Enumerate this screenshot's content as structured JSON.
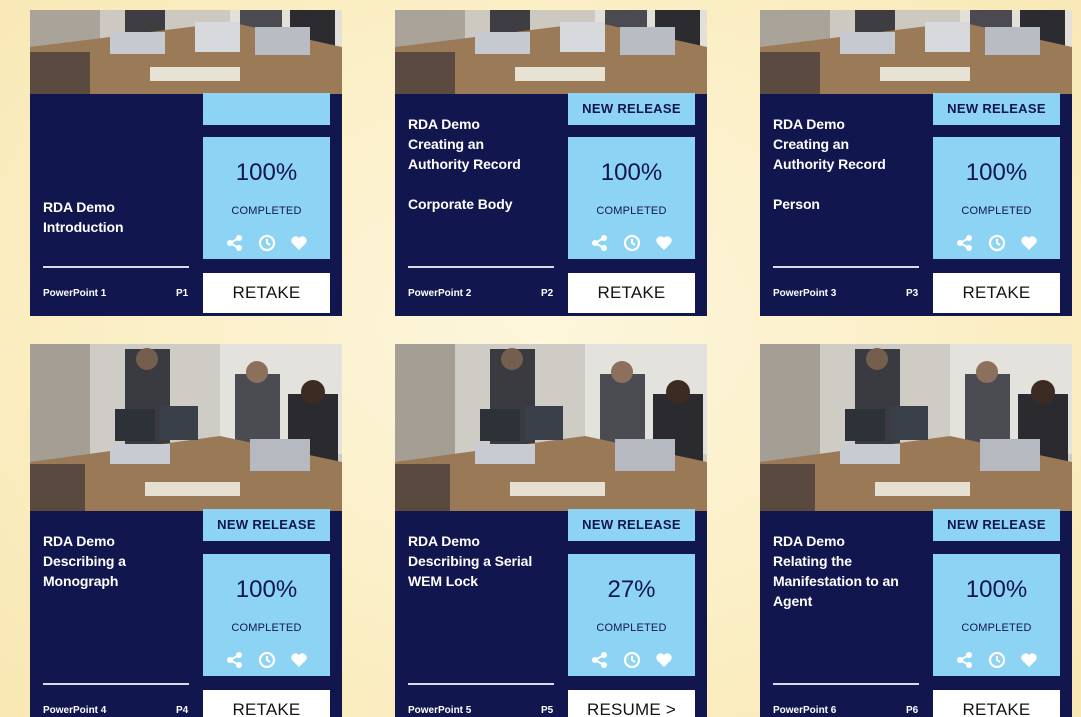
{
  "cards": [
    {
      "title": "RDA Demo\nIntroduction",
      "badge": "",
      "percent": "100%",
      "status": "COMPLETED",
      "footer_name": "PowerPoint 1",
      "footer_code": "P1",
      "action": "RETAKE"
    },
    {
      "title": "RDA Demo\nCreating an\nAuthority Record\n\nCorporate Body",
      "badge": "NEW RELEASE",
      "percent": "100%",
      "status": "COMPLETED",
      "footer_name": "PowerPoint 2",
      "footer_code": "P2",
      "action": "RETAKE"
    },
    {
      "title": "RDA Demo\nCreating an\nAuthority Record\n\nPerson",
      "badge": "NEW RELEASE",
      "percent": "100%",
      "status": "COMPLETED",
      "footer_name": "PowerPoint 3",
      "footer_code": "P3",
      "action": "RETAKE"
    },
    {
      "title": "RDA Demo\nDescribing a\nMonograph",
      "badge": "NEW RELEASE",
      "percent": "100%",
      "status": "COMPLETED",
      "footer_name": "PowerPoint 4",
      "footer_code": "P4",
      "action": "RETAKE"
    },
    {
      "title": "RDA Demo\nDescribing a Serial\nWEM Lock",
      "badge": "NEW RELEASE",
      "percent": "27%",
      "status": "COMPLETED",
      "footer_name": "PowerPoint 5",
      "footer_code": "P5",
      "action": "RESUME >"
    },
    {
      "title": "RDA Demo\nRelating the\nManifestation to an\nAgent",
      "badge": "NEW RELEASE",
      "percent": "100%",
      "status": "COMPLETED",
      "footer_name": "PowerPoint 6",
      "footer_code": "P6",
      "action": "RETAKE"
    }
  ],
  "colors": {
    "card_background": "#12164e",
    "panel": "#8dd3f3",
    "panel_text": "#12164e",
    "page_background": "#fbefc6",
    "button": "#ffffff"
  },
  "icons": [
    "share-icon",
    "clock-icon",
    "heart-icon"
  ]
}
